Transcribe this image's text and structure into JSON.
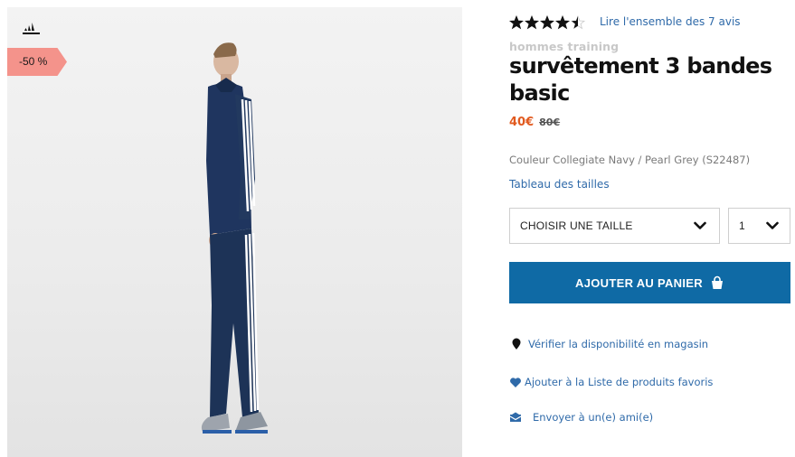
{
  "colors": {
    "accent": "#0f6aa5",
    "link": "#2f6aa9",
    "price": "#e15a1f",
    "badge": "#f4938b"
  },
  "image": {
    "brand_logo_icon": "adidas-logo-icon",
    "discount_badge": "-50 %"
  },
  "rating": {
    "value": 4.5,
    "max": 5,
    "reviews_link": "Lire l'ensemble des 7 avis"
  },
  "product": {
    "category": "hommes training",
    "title": "survêtement 3 bandes basic",
    "price_current": "40€",
    "price_old": "80€",
    "color_info": "Couleur Collegiate Navy / Pearl Grey (S22487)",
    "size_guide_link": "Tableau des tailles"
  },
  "selectors": {
    "size_value": "CHOISIR UNE TAILLE",
    "quantity_value": "1"
  },
  "cart": {
    "button_label": "AJOUTER AU PANIER",
    "icon": "shopping-bag-icon"
  },
  "actions": [
    {
      "icon": "map-pin-icon",
      "label": "Vérifier la disponibilité en magasin"
    },
    {
      "icon": "heart-icon",
      "label": "Ajouter à la Liste de produits favoris"
    },
    {
      "icon": "envelope-icon",
      "label": "Envoyer à un(e) ami(e)"
    }
  ]
}
